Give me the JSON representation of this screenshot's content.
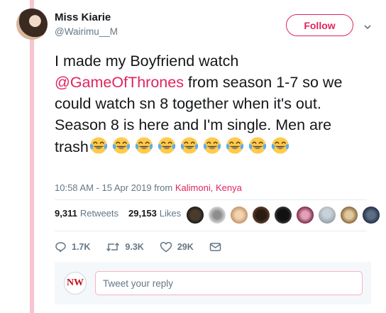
{
  "author": {
    "name": "Miss Kiarie",
    "handle": "@Wairimu__M"
  },
  "follow_button": {
    "label": "Follow"
  },
  "tweet": {
    "text_before_mention": "I made  my Boyfriend watch ",
    "mention": "@GameOfThrones",
    "text_after_mention": " from season 1-7 so we could watch sn 8 together when it's out. Season 8 is here and I'm single. Men are trash",
    "emoji_name": "face-with-tears-of-joy",
    "emoji_count": 9
  },
  "meta": {
    "time": "10:58 AM - 15 Apr 2019",
    "from_label": "from",
    "place": "Kalimoni, Kenya"
  },
  "stats": {
    "retweets_count": "9,311",
    "retweets_label": "Retweets",
    "likes_count": "29,153",
    "likes_label": "Likes"
  },
  "actions": {
    "replies": "1.7K",
    "retweets": "9.3K",
    "likes": "29K"
  },
  "reply": {
    "avatar_text": "NW",
    "placeholder": "Tweet your reply"
  },
  "colors": {
    "accent": "#e0245e",
    "thread_line": "#f7c4cf",
    "secondary_text": "#657786"
  }
}
